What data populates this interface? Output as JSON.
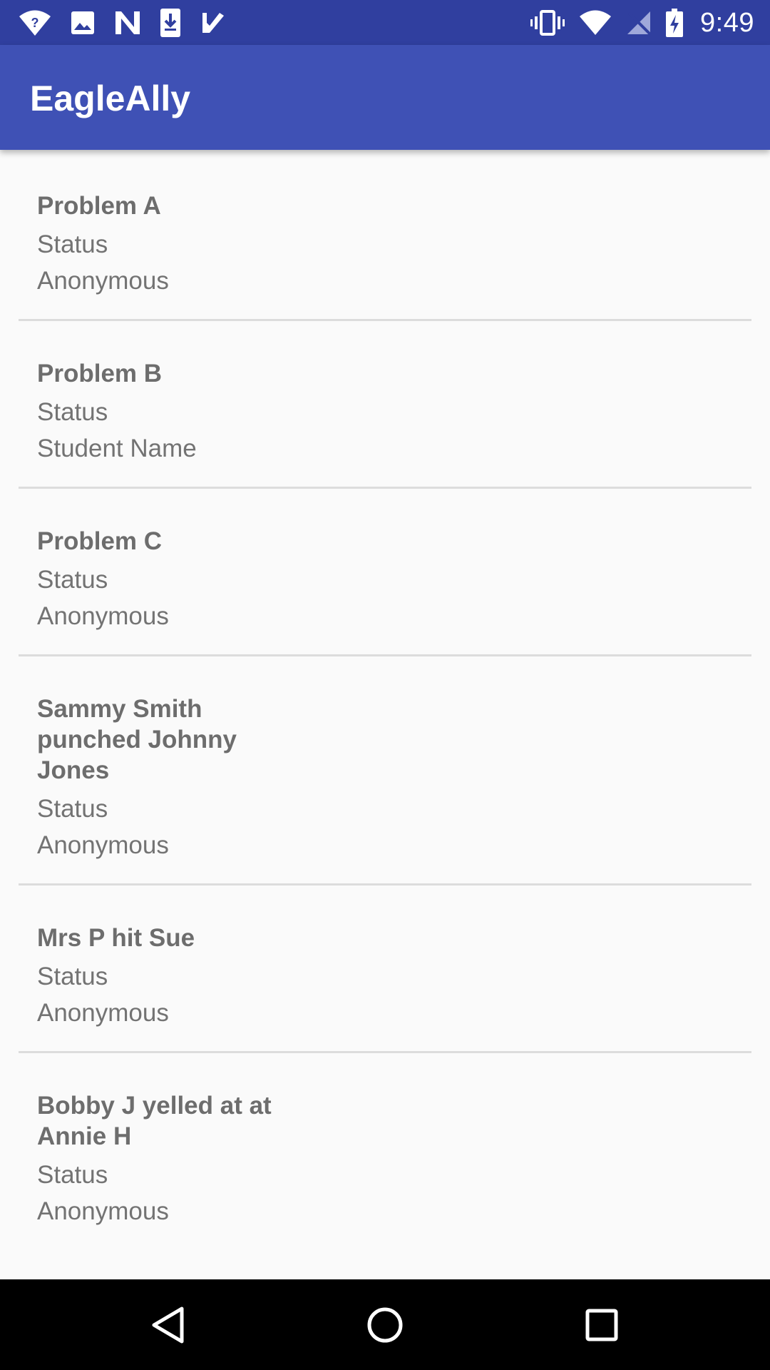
{
  "status_bar": {
    "time": "9:49",
    "left_icons": [
      "wifi-question-icon",
      "image-icon",
      "n-logo-icon",
      "download-icon",
      "check-icon"
    ],
    "right_icons": [
      "vibrate-icon",
      "wifi-icon",
      "no-signal-icon",
      "battery-charging-icon"
    ]
  },
  "app_bar": {
    "title": "EagleAlly",
    "color": "#3f51b5",
    "status_color": "#303f9f"
  },
  "reports": [
    {
      "title": "Problem A",
      "status": "Status",
      "reporter": "Anonymous"
    },
    {
      "title": "Problem B",
      "status": "Status",
      "reporter": "Student Name"
    },
    {
      "title": "Problem C",
      "status": "Status",
      "reporter": "Anonymous"
    },
    {
      "title": "Sammy Smith punched Johnny Jones",
      "status": "Status",
      "reporter": "Anonymous"
    },
    {
      "title": "Mrs P hit Sue",
      "status": "Status",
      "reporter": "Anonymous"
    },
    {
      "title": "Bobby J yelled at at Annie H",
      "status": "Status",
      "reporter": "Anonymous"
    }
  ],
  "nav_bar": {
    "icons": [
      "back-icon",
      "home-icon",
      "recents-icon"
    ]
  }
}
